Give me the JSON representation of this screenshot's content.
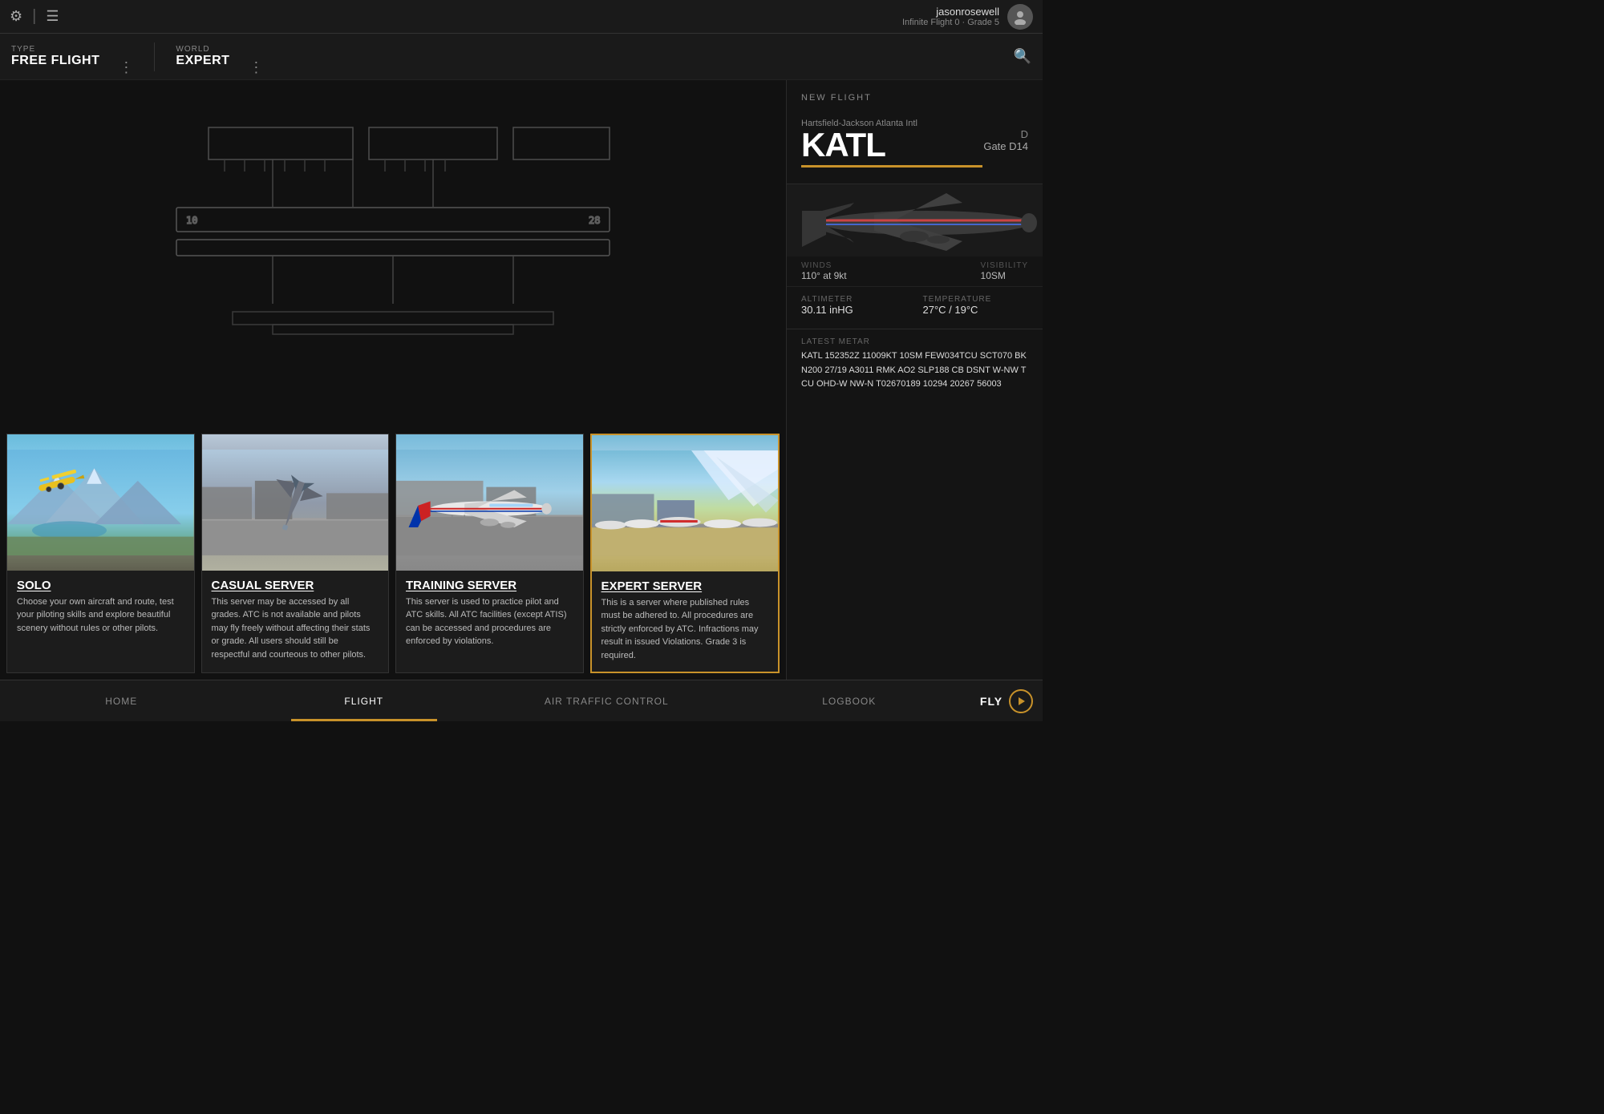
{
  "topbar": {
    "username": "jasonrosewell",
    "grade": "Infinite Flight 0 · Grade 5",
    "settings_icon": "⚙",
    "log_icon": "☰",
    "avatar_icon": "👤"
  },
  "filterbar": {
    "type_label": "TYPE",
    "type_value": "FREE FLIGHT",
    "world_label": "WORLD",
    "world_value": "EXPERT",
    "search_icon": "🔍"
  },
  "right_panel": {
    "section_label": "NEW FLIGHT",
    "airport_subtitle": "Hartsfield-Jackson Atlanta Intl",
    "airport_code": "KATL",
    "gate_letter": "D",
    "gate_value": "Gate D14",
    "weather": {
      "altimeter_label": "ALTIMETER",
      "altimeter_value": "30.11 inHG",
      "temperature_label": "TEMPERATURE",
      "temperature_value": "27°C / 19°C"
    },
    "metar_label": "LATEST METAR",
    "metar_value": "KATL 152352Z 11009KT 10SM FEW034TCU SCT070 BKN200 27/19 A3011 RMK AO2 SLP188 CB DSNT W-NW TCU OHD-W NW-N T02670189 10294 20267 56003"
  },
  "server_cards": [
    {
      "id": "solo",
      "title": "SOLO",
      "description": "Choose your own aircraft and route, test your piloting skills and explore beautiful scenery without rules or other pilots.",
      "selected": false,
      "image_type": "solo"
    },
    {
      "id": "casual",
      "title": "CASUAL SERVER",
      "description": "This server may be accessed by all grades. ATC is not available and pilots may fly freely without affecting their stats or grade. All users should still be respectful and courteous to other pilots.",
      "selected": false,
      "image_type": "casual"
    },
    {
      "id": "training",
      "title": "TRAINING SERVER",
      "description": "This server is used to practice pilot and ATC skills. All ATC facilities (except ATIS) can be accessed and procedures are enforced by violations.",
      "selected": false,
      "image_type": "training"
    },
    {
      "id": "expert",
      "title": "EXPERT SERVER",
      "description": "This is a server where published rules must be adhered to. All procedures are strictly enforced by ATC. Infractions may result in issued Violations. Grade 3 is required.",
      "selected": true,
      "image_type": "expert"
    }
  ],
  "bottom_nav": {
    "items": [
      {
        "id": "home",
        "label": "HOME",
        "active": false
      },
      {
        "id": "flight",
        "label": "FLIGHT",
        "active": true
      },
      {
        "id": "atc",
        "label": "AIR TRAFFIC CONTROL",
        "active": false
      },
      {
        "id": "logbook",
        "label": "LOGBOOK",
        "active": false
      }
    ],
    "fly_label": "FLY"
  },
  "colors": {
    "accent": "#c8922a",
    "bg_dark": "#111111",
    "bg_medium": "#1a1a1a",
    "text_muted": "#888888",
    "border": "#333333"
  }
}
